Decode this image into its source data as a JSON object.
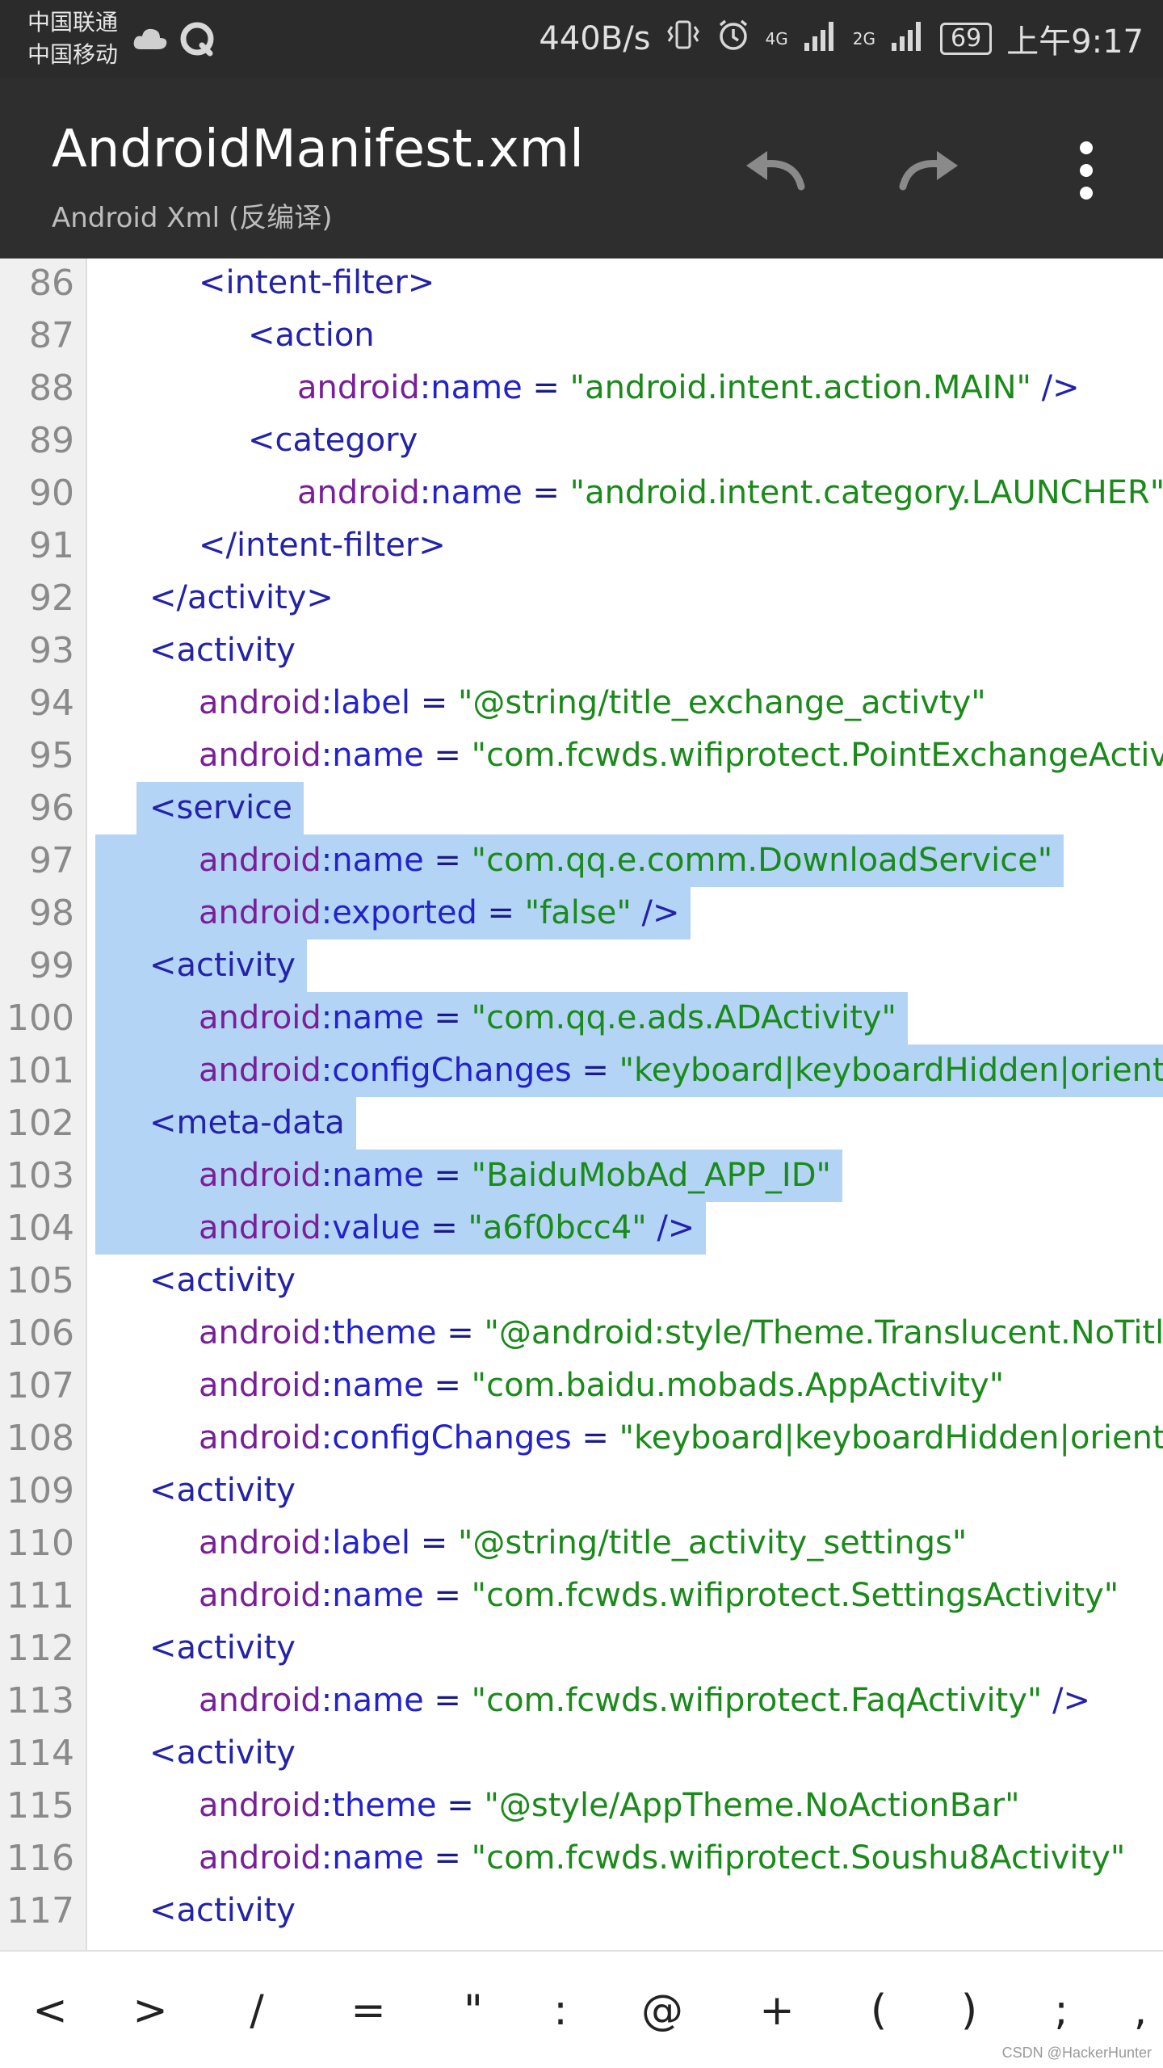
{
  "status_bar": {
    "carrier1": "中国联通",
    "carrier2": "中国移动",
    "net_speed": "440B/s",
    "net4g": "4G",
    "net2g": "2G",
    "battery": "69",
    "time": "上午9:17"
  },
  "toolbar": {
    "title": "AndroidManifest.xml",
    "subtitle": "Android Xml (反编译)"
  },
  "lines": [
    {
      "n": "86",
      "indent": 2,
      "parts": [
        [
          "tag",
          "<intent-filter>"
        ]
      ]
    },
    {
      "n": "87",
      "indent": 3,
      "parts": [
        [
          "tag",
          "<action"
        ]
      ]
    },
    {
      "n": "88",
      "indent": 4,
      "parts": [
        [
          "ns",
          "android"
        ],
        [
          "attr",
          ":name"
        ],
        [
          "eq",
          " = "
        ],
        [
          "str",
          "\"android.intent.action.MAIN\""
        ],
        [
          "tag",
          " />"
        ]
      ]
    },
    {
      "n": "89",
      "indent": 3,
      "parts": [
        [
          "tag",
          "<category"
        ]
      ]
    },
    {
      "n": "90",
      "indent": 4,
      "parts": [
        [
          "ns",
          "android"
        ],
        [
          "attr",
          ":name"
        ],
        [
          "eq",
          " = "
        ],
        [
          "str",
          "\"android.intent.category.LAUNCHER\""
        ]
      ]
    },
    {
      "n": "91",
      "indent": 2,
      "parts": [
        [
          "tag",
          "</intent-filter>"
        ]
      ]
    },
    {
      "n": "92",
      "indent": 1,
      "parts": [
        [
          "tag",
          "</activity>"
        ]
      ]
    },
    {
      "n": "93",
      "indent": 1,
      "parts": [
        [
          "tag",
          "<activity"
        ]
      ]
    },
    {
      "n": "94",
      "indent": 2,
      "parts": [
        [
          "ns",
          "android"
        ],
        [
          "attr",
          ":label"
        ],
        [
          "eq",
          " = "
        ],
        [
          "str",
          "\"@string/title_exchange_activty\""
        ]
      ]
    },
    {
      "n": "95",
      "indent": 2,
      "parts": [
        [
          "ns",
          "android"
        ],
        [
          "attr",
          ":name"
        ],
        [
          "eq",
          " = "
        ],
        [
          "str",
          "\"com.fcwds.wifiprotect.PointExchangeActivity\""
        ]
      ]
    },
    {
      "n": "96",
      "indent": 1,
      "parts": [
        [
          "tag",
          "<service"
        ]
      ]
    },
    {
      "n": "97",
      "indent": 2,
      "parts": [
        [
          "ns",
          "android"
        ],
        [
          "attr",
          ":name"
        ],
        [
          "eq",
          " = "
        ],
        [
          "str",
          "\"com.qq.e.comm.DownloadService\""
        ]
      ]
    },
    {
      "n": "98",
      "indent": 2,
      "parts": [
        [
          "ns",
          "android"
        ],
        [
          "attr",
          ":exported"
        ],
        [
          "eq",
          " = "
        ],
        [
          "str",
          "\"false\""
        ],
        [
          "tag",
          " />"
        ]
      ]
    },
    {
      "n": "99",
      "indent": 1,
      "parts": [
        [
          "tag",
          "<activity"
        ]
      ]
    },
    {
      "n": "100",
      "indent": 2,
      "parts": [
        [
          "ns",
          "android"
        ],
        [
          "attr",
          ":name"
        ],
        [
          "eq",
          " = "
        ],
        [
          "str",
          "\"com.qq.e.ads.ADActivity\""
        ]
      ]
    },
    {
      "n": "101",
      "indent": 2,
      "parts": [
        [
          "ns",
          "android"
        ],
        [
          "attr",
          ":configChanges"
        ],
        [
          "eq",
          " = "
        ],
        [
          "str",
          "\"keyboard|keyboardHidden|orientation\""
        ]
      ]
    },
    {
      "n": "102",
      "indent": 1,
      "parts": [
        [
          "tag",
          "<meta-data"
        ]
      ]
    },
    {
      "n": "103",
      "indent": 2,
      "parts": [
        [
          "ns",
          "android"
        ],
        [
          "attr",
          ":name"
        ],
        [
          "eq",
          " = "
        ],
        [
          "str",
          "\"BaiduMobAd_APP_ID\""
        ]
      ]
    },
    {
      "n": "104",
      "indent": 2,
      "parts": [
        [
          "ns",
          "android"
        ],
        [
          "attr",
          ":value"
        ],
        [
          "eq",
          " = "
        ],
        [
          "str",
          "\"a6f0bcc4\""
        ],
        [
          "tag",
          " />"
        ]
      ]
    },
    {
      "n": "105",
      "indent": 1,
      "parts": [
        [
          "tag",
          "<activity"
        ]
      ]
    },
    {
      "n": "106",
      "indent": 2,
      "parts": [
        [
          "ns",
          "android"
        ],
        [
          "attr",
          ":theme"
        ],
        [
          "eq",
          " = "
        ],
        [
          "str",
          "\"@android:style/Theme.Translucent.NoTitleBar\""
        ]
      ]
    },
    {
      "n": "107",
      "indent": 2,
      "parts": [
        [
          "ns",
          "android"
        ],
        [
          "attr",
          ":name"
        ],
        [
          "eq",
          " = "
        ],
        [
          "str",
          "\"com.baidu.mobads.AppActivity\""
        ]
      ]
    },
    {
      "n": "108",
      "indent": 2,
      "parts": [
        [
          "ns",
          "android"
        ],
        [
          "attr",
          ":configChanges"
        ],
        [
          "eq",
          " = "
        ],
        [
          "str",
          "\"keyboard|keyboardHidden|orientation\""
        ]
      ]
    },
    {
      "n": "109",
      "indent": 1,
      "parts": [
        [
          "tag",
          "<activity"
        ]
      ]
    },
    {
      "n": "110",
      "indent": 2,
      "parts": [
        [
          "ns",
          "android"
        ],
        [
          "attr",
          ":label"
        ],
        [
          "eq",
          " = "
        ],
        [
          "str",
          "\"@string/title_activity_settings\""
        ]
      ]
    },
    {
      "n": "111",
      "indent": 2,
      "parts": [
        [
          "ns",
          "android"
        ],
        [
          "attr",
          ":name"
        ],
        [
          "eq",
          " = "
        ],
        [
          "str",
          "\"com.fcwds.wifiprotect.SettingsActivity\""
        ]
      ]
    },
    {
      "n": "112",
      "indent": 1,
      "parts": [
        [
          "tag",
          "<activity"
        ]
      ]
    },
    {
      "n": "113",
      "indent": 2,
      "parts": [
        [
          "ns",
          "android"
        ],
        [
          "attr",
          ":name"
        ],
        [
          "eq",
          " = "
        ],
        [
          "str",
          "\"com.fcwds.wifiprotect.FaqActivity\""
        ],
        [
          "tag",
          " />"
        ]
      ]
    },
    {
      "n": "114",
      "indent": 1,
      "parts": [
        [
          "tag",
          "<activity"
        ]
      ]
    },
    {
      "n": "115",
      "indent": 2,
      "parts": [
        [
          "ns",
          "android"
        ],
        [
          "attr",
          ":theme"
        ],
        [
          "eq",
          " = "
        ],
        [
          "str",
          "\"@style/AppTheme.NoActionBar\""
        ]
      ]
    },
    {
      "n": "116",
      "indent": 2,
      "parts": [
        [
          "ns",
          "android"
        ],
        [
          "attr",
          ":name"
        ],
        [
          "eq",
          " = "
        ],
        [
          "str",
          "\"com.fcwds.wifiprotect.Soushu8Activity\""
        ]
      ]
    },
    {
      "n": "117",
      "indent": 1,
      "parts": [
        [
          "tag",
          "<activity"
        ]
      ]
    }
  ],
  "selection": {
    "from_line": "96",
    "to_line": "104"
  },
  "symbols": [
    "<",
    ">",
    "/",
    "=",
    "\"",
    ":",
    "@",
    "+",
    "(",
    ")",
    ";",
    ","
  ],
  "watermark": "CSDN @HackerHunter"
}
